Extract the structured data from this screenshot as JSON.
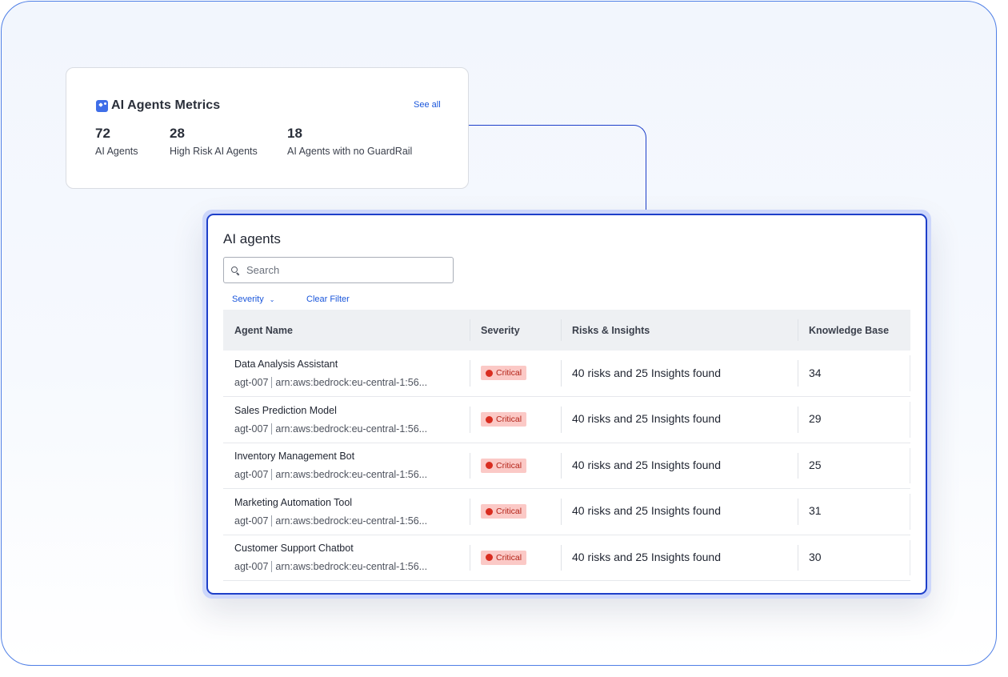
{
  "metrics": {
    "title": "AI Agents Metrics",
    "see_all": "See all",
    "items": [
      {
        "value": "72",
        "label": "AI Agents"
      },
      {
        "value": "28",
        "label": "High Risk AI Agents"
      },
      {
        "value": "18",
        "label": "AI Agents with no GuardRail"
      }
    ]
  },
  "agents": {
    "title": "AI agents",
    "search_placeholder": "Search",
    "filter_severity": "Severity",
    "clear_filter": "Clear Filter",
    "columns": [
      "Agent Name",
      "Severity",
      "Risks & Insights",
      "Knowledge Base"
    ],
    "rows": [
      {
        "name": "Data Analysis Assistant",
        "id": "agt-007",
        "arn": "arn:aws:bedrock:eu-central-1:56...",
        "severity": "Critical",
        "insights": "40 risks and 25 Insights found",
        "kb": "34"
      },
      {
        "name": "Sales Prediction Model",
        "id": "agt-007",
        "arn": "arn:aws:bedrock:eu-central-1:56...",
        "severity": "Critical",
        "insights": "40 risks and 25 Insights found",
        "kb": "29"
      },
      {
        "name": "Inventory Management Bot",
        "id": "agt-007",
        "arn": "arn:aws:bedrock:eu-central-1:56...",
        "severity": "Critical",
        "insights": "40 risks and 25 Insights found",
        "kb": "25"
      },
      {
        "name": "Marketing Automation Tool",
        "id": "agt-007",
        "arn": "arn:aws:bedrock:eu-central-1:56...",
        "severity": "Critical",
        "insights": "40 risks and 25 Insights found",
        "kb": "31"
      },
      {
        "name": "Customer Support Chatbot",
        "id": "agt-007",
        "arn": "arn:aws:bedrock:eu-central-1:56...",
        "severity": "Critical",
        "insights": "40 risks and 25 Insights found",
        "kb": "30"
      }
    ]
  },
  "colors": {
    "accent": "#1d3fc9",
    "link": "#1a56db",
    "critical_bg": "#fbc9c6",
    "critical_dot": "#d92d20"
  }
}
